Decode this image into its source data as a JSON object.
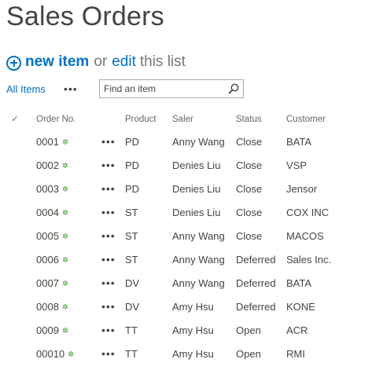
{
  "page": {
    "title": "Sales Orders"
  },
  "toolbar": {
    "new_item": "new item",
    "or": "or",
    "edit": "edit",
    "this_list": "this list"
  },
  "view": {
    "current": "All Items",
    "more": "•••",
    "search_placeholder": "Find an item"
  },
  "columns": {
    "check": "✓",
    "order_no": "Order No.",
    "product": "Product",
    "saler": "Saler",
    "status": "Status",
    "customer": "Customer"
  },
  "row_menu": "•••",
  "new_marker": "✲",
  "rows": [
    {
      "order": "0001",
      "product": "PD",
      "saler": "Anny Wang",
      "status": "Close",
      "customer": "BATA"
    },
    {
      "order": "0002",
      "product": "PD",
      "saler": "Denies Liu",
      "status": "Close",
      "customer": "VSP"
    },
    {
      "order": "0003",
      "product": "PD",
      "saler": "Denies Liu",
      "status": "Close",
      "customer": "Jensor"
    },
    {
      "order": "0004",
      "product": "ST",
      "saler": "Denies Liu",
      "status": "Close",
      "customer": "COX INC"
    },
    {
      "order": "0005",
      "product": "ST",
      "saler": "Anny Wang",
      "status": "Close",
      "customer": "MACOS"
    },
    {
      "order": "0006",
      "product": "ST",
      "saler": "Anny Wang",
      "status": "Deferred",
      "customer": "Sales Inc."
    },
    {
      "order": "0007",
      "product": "DV",
      "saler": "Anny Wang",
      "status": "Deferred",
      "customer": "BATA"
    },
    {
      "order": "0008",
      "product": "DV",
      "saler": "Amy Hsu",
      "status": "Deferred",
      "customer": "KONE"
    },
    {
      "order": "0009",
      "product": "TT",
      "saler": "Amy Hsu",
      "status": "Open",
      "customer": "ACR"
    },
    {
      "order": "00010",
      "product": "TT",
      "saler": "Amy Hsu",
      "status": "Open",
      "customer": "RMI"
    }
  ],
  "colors": {
    "accent": "#0072c6",
    "new_marker": "#3a9a2a",
    "text": "#444444"
  }
}
